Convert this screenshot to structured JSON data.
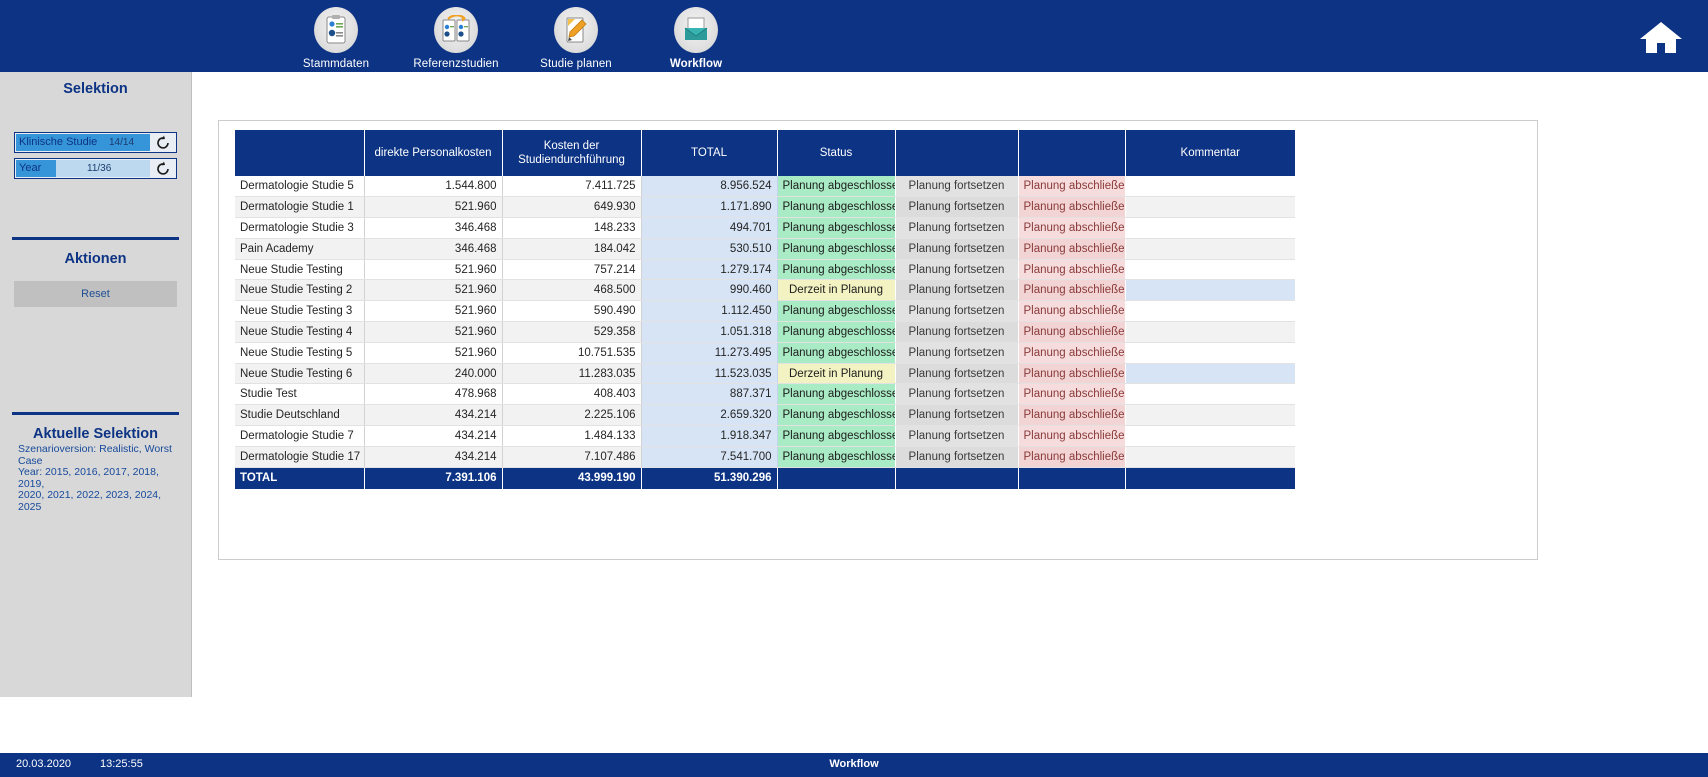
{
  "nav": {
    "items": [
      {
        "label": "Stammdaten",
        "icon": "clipboard-chart-icon",
        "active": false
      },
      {
        "label": "Referenzstudien",
        "icon": "two-documents-icon",
        "active": false
      },
      {
        "label": "Studie planen",
        "icon": "pencil-document-icon",
        "active": false
      },
      {
        "label": "Workflow",
        "icon": "inbox-tray-icon",
        "active": true
      }
    ],
    "home_icon": "home-icon"
  },
  "sidebar": {
    "title": "Selektion",
    "filters": [
      {
        "name": "Klinische Studie",
        "count": "14/14",
        "fill_percent": 100,
        "reset_icon": "reset-arrow-icon"
      },
      {
        "name": "Year",
        "count": "11/36",
        "fill_percent": 30,
        "reset_icon": "reset-arrow-icon"
      }
    ],
    "actions_heading": "Aktionen",
    "reset_label": "Reset",
    "current_selection_heading": "Aktuelle Selektion",
    "current_selection_lines": [
      "Szenarioversion: Realistic, Worst Case",
      "Year: 2015, 2016, 2017, 2018, 2019,",
      "2020, 2021, 2022, 2023, 2024, 2025"
    ]
  },
  "table": {
    "headers": [
      "",
      "direkte Personalkosten",
      "Kosten der Studiendurchführung",
      "TOTAL",
      "Status",
      "",
      "",
      "Kommentar"
    ],
    "rows": [
      {
        "name": "Dermatologie Studie 5",
        "personal": "1.544.800",
        "durchfuehrung": "7.411.725",
        "total": "8.956.524",
        "status": "Planung abgeschlossen",
        "status_kind": "done",
        "act1": "Planung fortsetzen",
        "act2": "Planung abschließen",
        "comment": ""
      },
      {
        "name": "Dermatologie Studie 1",
        "personal": "521.960",
        "durchfuehrung": "649.930",
        "total": "1.171.890",
        "status": "Planung abgeschlossen",
        "status_kind": "done",
        "act1": "Planung fortsetzen",
        "act2": "Planung abschließen",
        "comment": ""
      },
      {
        "name": "Dermatologie Studie 3",
        "personal": "346.468",
        "durchfuehrung": "148.233",
        "total": "494.701",
        "status": "Planung abgeschlossen",
        "status_kind": "done",
        "act1": "Planung fortsetzen",
        "act2": "Planung abschließen",
        "comment": ""
      },
      {
        "name": "Pain Academy",
        "personal": "346.468",
        "durchfuehrung": "184.042",
        "total": "530.510",
        "status": "Planung abgeschlossen",
        "status_kind": "done",
        "act1": "Planung fortsetzen",
        "act2": "Planung abschließen",
        "comment": ""
      },
      {
        "name": "Neue Studie Testing",
        "personal": "521.960",
        "durchfuehrung": "757.214",
        "total": "1.279.174",
        "status": "Planung abgeschlossen",
        "status_kind": "done",
        "act1": "Planung fortsetzen",
        "act2": "Planung abschließen",
        "comment": ""
      },
      {
        "name": "Neue Studie Testing 2",
        "personal": "521.960",
        "durchfuehrung": "468.500",
        "total": "990.460",
        "status": "Derzeit in Planung",
        "status_kind": "plan",
        "act1": "Planung fortsetzen",
        "act2": "Planung abschließen",
        "comment": ""
      },
      {
        "name": "Neue Studie Testing 3",
        "personal": "521.960",
        "durchfuehrung": "590.490",
        "total": "1.112.450",
        "status": "Planung abgeschlossen",
        "status_kind": "done",
        "act1": "Planung fortsetzen",
        "act2": "Planung abschließen",
        "comment": ""
      },
      {
        "name": "Neue Studie Testing 4",
        "personal": "521.960",
        "durchfuehrung": "529.358",
        "total": "1.051.318",
        "status": "Planung abgeschlossen",
        "status_kind": "done",
        "act1": "Planung fortsetzen",
        "act2": "Planung abschließen",
        "comment": ""
      },
      {
        "name": "Neue Studie Testing 5",
        "personal": "521.960",
        "durchfuehrung": "10.751.535",
        "total": "11.273.495",
        "status": "Planung abgeschlossen",
        "status_kind": "done",
        "act1": "Planung fortsetzen",
        "act2": "Planung abschließen",
        "comment": ""
      },
      {
        "name": "Neue Studie Testing 6",
        "personal": "240.000",
        "durchfuehrung": "11.283.035",
        "total": "11.523.035",
        "status": "Derzeit in Planung",
        "status_kind": "plan",
        "act1": "Planung fortsetzen",
        "act2": "Planung abschließen",
        "comment": ""
      },
      {
        "name": "Studie Test",
        "personal": "478.968",
        "durchfuehrung": "408.403",
        "total": "887.371",
        "status": "Planung abgeschlossen",
        "status_kind": "done",
        "act1": "Planung fortsetzen",
        "act2": "Planung abschließen",
        "comment": ""
      },
      {
        "name": "Studie Deutschland",
        "personal": "434.214",
        "durchfuehrung": "2.225.106",
        "total": "2.659.320",
        "status": "Planung abgeschlossen",
        "status_kind": "done",
        "act1": "Planung fortsetzen",
        "act2": "Planung abschließen",
        "comment": ""
      },
      {
        "name": "Dermatologie Studie 7",
        "personal": "434.214",
        "durchfuehrung": "1.484.133",
        "total": "1.918.347",
        "status": "Planung abgeschlossen",
        "status_kind": "done",
        "act1": "Planung fortsetzen",
        "act2": "Planung abschließen",
        "comment": ""
      },
      {
        "name": "Dermatologie Studie 17",
        "personal": "434.214",
        "durchfuehrung": "7.107.486",
        "total": "7.541.700",
        "status": "Planung abgeschlossen",
        "status_kind": "done",
        "act1": "Planung fortsetzen",
        "act2": "Planung abschließen",
        "comment": ""
      }
    ],
    "total_row": {
      "name": "TOTAL",
      "personal": "7.391.106",
      "durchfuehrung": "43.999.190",
      "total": "51.390.296"
    }
  },
  "statusbar": {
    "date": "20.03.2020",
    "time": "13:25:55",
    "center": "Workflow"
  },
  "colors": {
    "brand_blue": "#0c3384",
    "status_done_bg": "#a9ebc4",
    "status_plan_bg": "#f2f2c2",
    "total_col_bg": "#d7e4f5",
    "act_complete_bg": "#f6dcdc",
    "sidebar_bg": "#d8d8d8"
  }
}
